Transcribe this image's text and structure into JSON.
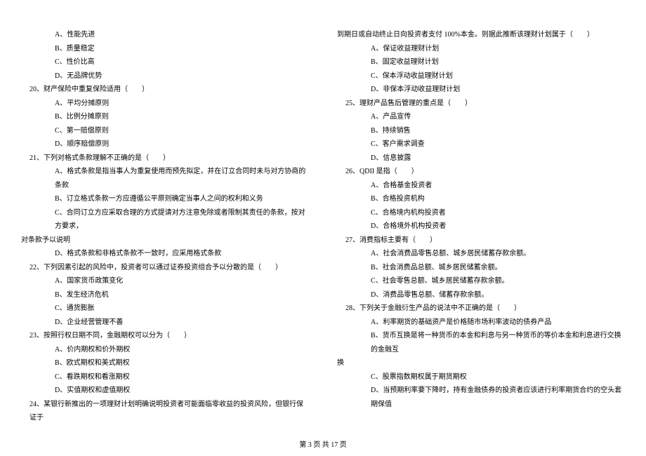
{
  "left": {
    "q19_opts": {
      "a": "A、性能先进",
      "b": "B、质量稳定",
      "c": "C、性价比高",
      "d": "D、无品牌优势"
    },
    "q20": {
      "stem": "20、财产保险中重复保险适用（　　）",
      "a": "A、平均分摊原则",
      "b": "B、比例分摊原则",
      "c": "C、第一赔偿原则",
      "d": "D、顺序赔偿原则"
    },
    "q21": {
      "stem": "21、下列对格式条款理解不正确的是（　　）",
      "a": "A、格式条款是指当事人为重复使用而预先拟定，并在订立合同时未与对方协商的条款",
      "b": "B、订立格式条款一方应遵循公平原则确定当事人之间的权利和义务",
      "c_line1": "C、合同订立方应采取合理的方式提请对方注意免除或者限制其责任的条款，按对方要求，",
      "c_line2": "对条款予以说明",
      "d": "D、格式条款和非格式条款不一致时，应采用格式条款"
    },
    "q22": {
      "stem": "22、下列因素引起的风险中，投资者可以通过证券投资组合予以分散的是（　　）",
      "a": "A、国家货币政策变化",
      "b": "B、发生经济危机",
      "c": "C、通货膨胀",
      "d": "D、企业经营管理不善"
    },
    "q23": {
      "stem": "23、按照行权日期不同，金融期权可以分为（　　）",
      "a": "A、价内期权和价外期权",
      "b": "B、欧式期权和美式期权",
      "c": "C、看跌期权和看涨期权",
      "d": "D、实值期权和虚值期权"
    },
    "q24": {
      "stem": "24、某银行新推出的一项理财计划明确说明投资者可能面临零收益的投资风险，但银行保证于"
    }
  },
  "right": {
    "q24_cont": "到期日或自动终止日向投资者支付 100%本金。则据此推断该理财计划属于（　　）",
    "q24_opts": {
      "a": "A、保证收益理财计划",
      "b": "B、固定收益理财计划",
      "c": "C、保本浮动收益理财计划",
      "d": "D、非保本浮动收益理财计划"
    },
    "q25": {
      "stem": "25、理财产品售后管理的重点是（　　）",
      "a": "A、产品宣传",
      "b": "B、持续销售",
      "c": "C、客户需求调查",
      "d": "D、信息披露"
    },
    "q26": {
      "stem": "26、QDII 是指（　　）",
      "a": "A、合格基金投资者",
      "b": "B、合格投资机构",
      "c": "C、合格境内机构投资者",
      "d": "D、合格境外机构投资者"
    },
    "q27": {
      "stem": "27、消费指标主要有（　　）",
      "a": "A、社会消费品零售总额、城乡居民储蓄存款余额。",
      "b": "B、社会消费品总额、城乡居民储蓄余额。",
      "c": "C、社会零售总额、城乡居民储蓄存款余额。",
      "d": "D、消费品零售总额、储蓄存款余额。"
    },
    "q28": {
      "stem": "28、下列关于金融衍生产品的说法中不正确的是（　　）",
      "a": "A、利率期货的基础资产是价格随市场利率波动的债券产品",
      "b_line1": "B、货币互换是将一种货币的本金和利息与另一种货币的等价本金和利息进行交换的金融互",
      "b_line2": "换",
      "c": "C、股票指数期权属于期货期权",
      "d": "D、当预期利率要下降时，持有金融债券的投资者应该进行利率期货合约的空头套期保值"
    }
  },
  "footer": "第 3 页 共 17 页"
}
